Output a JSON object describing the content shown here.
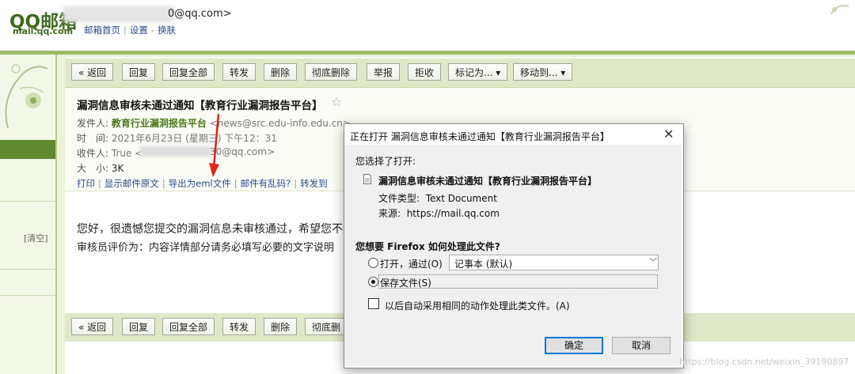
{
  "header": {
    "logo": "QQ邮箱",
    "logo_sub": "mail.qq.com",
    "email": "0@qq.com>",
    "links": [
      "邮箱首页",
      "设置",
      "换肤"
    ]
  },
  "left": {
    "clear": "[清空]"
  },
  "toolbar": {
    "buttons": [
      "« 返回",
      "回复",
      "回复全部",
      "转发",
      "删除",
      "彻底删除",
      "举报",
      "拒收",
      "标记为... ▾",
      "移动到... ▾"
    ]
  },
  "toolbar2": {
    "buttons": [
      "« 返回",
      "回复",
      "回复全部",
      "转发",
      "删除",
      "彻底删"
    ]
  },
  "mail": {
    "subject": "漏洞信息审核未通过通知【教育行业漏洞报告平台】",
    "from_label": "发件人:",
    "from_name": "教育行业漏洞报告平台",
    "from_addr": "<news@src.edu-info.edu.cn>",
    "time_label": "时　间:",
    "time_value": "2021年6月23日 (星期三) 下午12：31",
    "to_label": "收件人:",
    "to_value": "True <",
    "to_tail": "30@qq.com>",
    "size_label": "大　小:",
    "size_value": "3K",
    "actions": [
      "打印",
      "显示邮件原文",
      "导出为eml文件",
      "邮件有乱码?",
      "转发到"
    ],
    "body_line1": "您好，很遗憾您提交的漏洞信息未审核通过，希望您不要",
    "body_line2": "审核员评价为：内容详情部分请务必填写必要的文字说明"
  },
  "dialog": {
    "title": "正在打开 漏洞信息审核未通过通知【教育行业漏洞报告平台】",
    "chosen": "您选择了打开:",
    "filename": "漏洞信息审核未通过通知【教育行业漏洞报告平台】",
    "type_label": "文件类型:",
    "type_value": "Text Document",
    "source_label": "来源:",
    "source_value": "https://mail.qq.com",
    "question": "您想要 Firefox 如何处理此文件?",
    "open_with_label": "打开，通过(O)",
    "open_with_app": "记事本 (默认)",
    "save_label": "保存文件(S)",
    "auto_label": "以后自动采用相同的动作处理此类文件。(A)",
    "ok": "确定",
    "cancel": "取消",
    "selected_option": "save"
  },
  "watermark": "https://blog.csdn.net/weixin_39190897",
  "colors": {
    "brand_green": "#3d6b1e",
    "band": "#9cba6a",
    "link": "#2b4a8a",
    "arrow": "#e2231a",
    "focus": "#0078d7"
  }
}
